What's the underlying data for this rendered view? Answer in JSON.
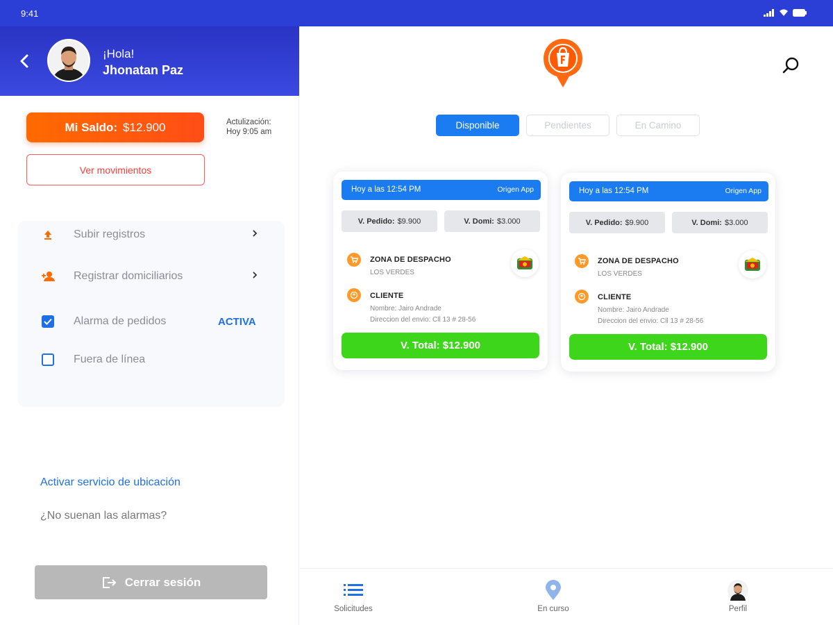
{
  "status_bar": {
    "time": "9:41"
  },
  "sidebar": {
    "greeting": "¡Hola!",
    "user_name": "Jhonatan Paz",
    "balance": {
      "label": "Mi Saldo:",
      "amount": "$12.900"
    },
    "update": {
      "label": "Actulización:",
      "time": "Hoy 9:05 am"
    },
    "movements_label": "Ver movimientos",
    "menu": {
      "upload_label": "Subir registros",
      "register_label": "Registrar domiciliarios",
      "alarm_label": "Alarma de pedidos",
      "alarm_status": "ACTIVA",
      "alarm_checked": true,
      "offline_label": "Fuera de línea",
      "offline_checked": false
    },
    "location_link": "Activar servicio de ubicación",
    "alarms_question": "¿No suenan las alarmas?",
    "logout_label": "Cerrar sesión"
  },
  "main": {
    "tabs": [
      {
        "label": "Disponible",
        "active": true
      },
      {
        "label": "Pendientes",
        "active": false
      },
      {
        "label": "En Camino",
        "active": false
      }
    ],
    "orders": [
      {
        "when": "Hoy a las 12:54 PM",
        "origin": "Origen App",
        "order_value_label": "V. Pedido:",
        "order_value": "$9.900",
        "delivery_value_label": "V. Domi:",
        "delivery_value": "$3.000",
        "zone_title": "ZONA DE DESPACHO",
        "zone_name": "LOS VERDES",
        "client_title": "CLIENTE",
        "client_name": "Nombre: Jairo Andrade",
        "client_address": "Direccion del envio: Cll 13 # 28-56",
        "total": "V. Total: $12.900"
      },
      {
        "when": "Hoy a las 12:54 PM",
        "origin": "Origen App",
        "order_value_label": "V. Pedido:",
        "order_value": "$9.900",
        "delivery_value_label": "V. Domi:",
        "delivery_value": "$3.000",
        "zone_title": "ZONA DE DESPACHO",
        "zone_name": "LOS VERDES",
        "client_title": "CLIENTE",
        "client_name": "Nombre: Jairo Andrade",
        "client_address": "Direccion del envio: Cll 13 # 28-56",
        "total": "V. Total: $12.900"
      }
    ]
  },
  "bottom_nav": {
    "items": [
      {
        "label": "Solicitudes",
        "icon": "list-icon"
      },
      {
        "label": "En curso",
        "icon": "location-pin-icon"
      },
      {
        "label": "Perfil",
        "icon": "avatar"
      }
    ]
  },
  "colors": {
    "header_blue": "#2b3fd6",
    "accent_blue": "#1a7cf0",
    "balance_orange": "#ff5a10",
    "total_green": "#3ed61a",
    "logout_gray": "#b8b8b8"
  }
}
